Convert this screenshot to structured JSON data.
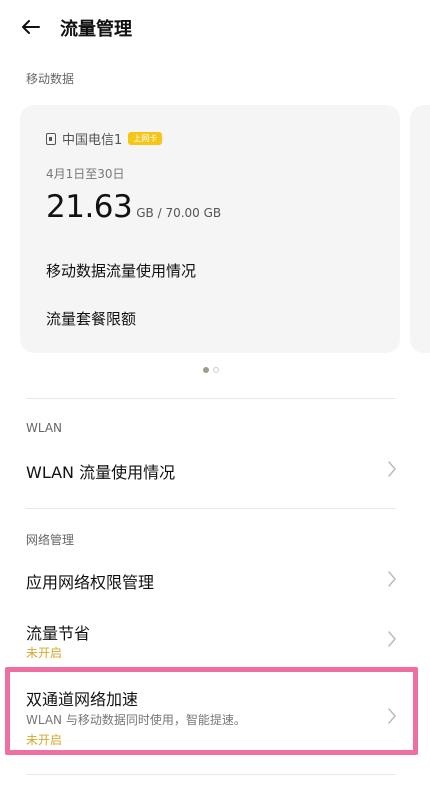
{
  "header": {
    "title": "流量管理"
  },
  "mobile_data": {
    "section_label": "移动数据",
    "carrier": "中国电信1",
    "plan_badge": "上网卡",
    "period": "4月1日至30日",
    "used": "21.63",
    "used_unit_total": "GB / 70.00 GB",
    "usage_details": "移动数据流量使用情况",
    "plan_limit": "流量套餐限额"
  },
  "wlan": {
    "section_label": "WLAN",
    "usage": "WLAN 流量使用情况"
  },
  "network": {
    "section_label": "网络管理",
    "app_permissions": "应用网络权限管理",
    "data_saver": {
      "title": "流量节省",
      "status": "未开启"
    },
    "dual_channel": {
      "title": "双通道网络加速",
      "description": "WLAN 与移动数据同时使用，智能提速。",
      "status": "未开启"
    }
  },
  "colors": {
    "accent_status": "#d4a82a",
    "highlight_border": "#f06fa3",
    "card_bg": "#f5f5f5",
    "badge": "#f5c518"
  }
}
